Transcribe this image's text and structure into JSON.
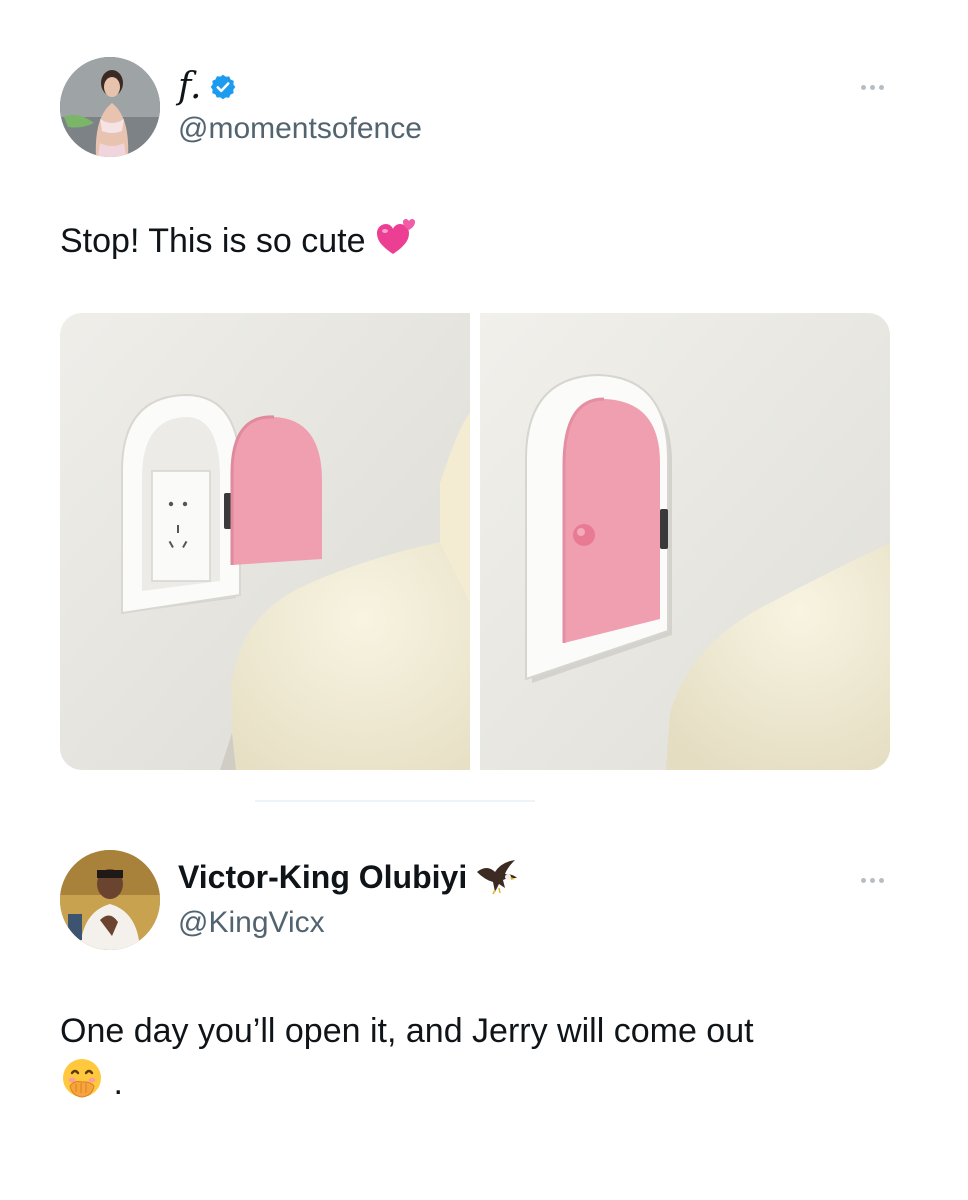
{
  "tweet1": {
    "display_name": "f.",
    "handle": "@momentsofence",
    "verified": true,
    "text": "Stop! This is so cute",
    "emoji": "sparkling-heart-emoji"
  },
  "tweet2": {
    "display_name": "Victor-King Olubiyi",
    "handle": "@KingVicx",
    "badge_emoji": "eagle-emoji",
    "text": "One day you’ll open it, and Jerry will come out",
    "trailing_text": ".",
    "emoji": "face-with-hand-over-mouth-emoji"
  },
  "colors": {
    "verified_blue": "#1d9bf0",
    "handle_gray": "#536471",
    "door_pink": "#ef9fb0",
    "wall": "#ecebe6"
  }
}
